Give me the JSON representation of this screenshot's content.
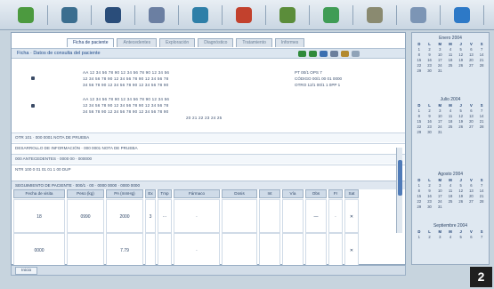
{
  "toolbar": {
    "icons": [
      {
        "name": "home-icon",
        "color": "#4c9a3f"
      },
      {
        "name": "gear-icon",
        "color": "#3b6e8f"
      },
      {
        "name": "moon-icon",
        "color": "#2a4d7a"
      },
      {
        "name": "chart-icon",
        "color": "#6b7fa2"
      },
      {
        "name": "car-icon",
        "color": "#2e7fa8"
      },
      {
        "name": "user-icon",
        "color": "#c2412d"
      },
      {
        "name": "globe-icon",
        "color": "#5b8d3a"
      },
      {
        "name": "book-icon",
        "color": "#3f9c55"
      },
      {
        "name": "tools-icon",
        "color": "#8a8a70"
      },
      {
        "name": "document-icon",
        "color": "#7c95b5"
      },
      {
        "name": "info-icon",
        "color": "#2d79c7"
      }
    ]
  },
  "tabs": [
    "Ficha de paciente",
    "Antecedentes",
    "Exploración",
    "Diagnóstico",
    "Tratamiento",
    "Informes"
  ],
  "header": {
    "title": "Ficha · Datos de consulta del paciente"
  },
  "block1": {
    "line1": "AA 12 34 56 78 90 12 34 56 78 90 12 34 56",
    "line2": "12 34 56 78 90 12 34 56 78 90 12 34 56 78",
    "line3": "34 56 78 90 12 34 56 78 90 12 34 56 78 90",
    "side1": "PT 00/1 OPS 7",
    "side2": "CÓDIGO 00/1 00 01 0000",
    "side3": "OTRO 12/1 00/1 1 0PP 1"
  },
  "block2": {
    "line1": "AA 12 34 56 78 90 12 34 56 78 90 12 34 56",
    "line2": "12 34 56 78 90 12 34 56 78 90 12 34 56 78",
    "line3": "34 56 78 90 12 34 56 78 90 12 34 56 78 90",
    "line4": "20 21 22 23 24 25"
  },
  "rows": [
    "OTR 101 · 000 0001 NOTA DE PRUEBA",
    "DESARROLLO DE INFORMACIÓN · 000 0001 NOTA DE PRUEBA",
    "000 ANTECEDENTES · 0000 00 · 000000",
    "NTR 100 0 01 01 01 1 00 DUP"
  ],
  "table": {
    "title": "SEGUIMIENTO DE PACIENTE · 000/1 · 00 · 0000 0000 · 0000 0000",
    "columns": [
      "Fecha de visita",
      "Peso (kg)",
      "PA (mmHg)",
      "Ex",
      "Tmp",
      "Fármaco",
      "Dosis",
      "Int",
      "Vía",
      "Obs",
      "Fr",
      "Sat"
    ],
    "rows": [
      [
        "18",
        "0990",
        "2000",
        "3",
        "···",
        "·",
        "",
        "",
        "",
        "—",
        "·",
        "✕"
      ],
      [
        "0000",
        "",
        "7.79",
        "",
        "",
        "·",
        "",
        "",
        "",
        "",
        "",
        "✕"
      ]
    ]
  },
  "statusbar": {
    "tab": "Inicio"
  },
  "calendars": [
    {
      "title": "Enero 2004",
      "days": [
        "D",
        "L",
        "M",
        "M",
        "J",
        "V",
        "S"
      ]
    },
    {
      "title": "Julio 2004",
      "days": [
        "D",
        "L",
        "M",
        "M",
        "J",
        "V",
        "S"
      ]
    },
    {
      "title": "Agosto 2004",
      "days": [
        "D",
        "L",
        "M",
        "M",
        "J",
        "V",
        "S"
      ]
    },
    {
      "title": "Septiembre 2004",
      "days": [
        "D",
        "L",
        "M",
        "M",
        "J",
        "V",
        "S"
      ]
    }
  ],
  "badge": "2"
}
